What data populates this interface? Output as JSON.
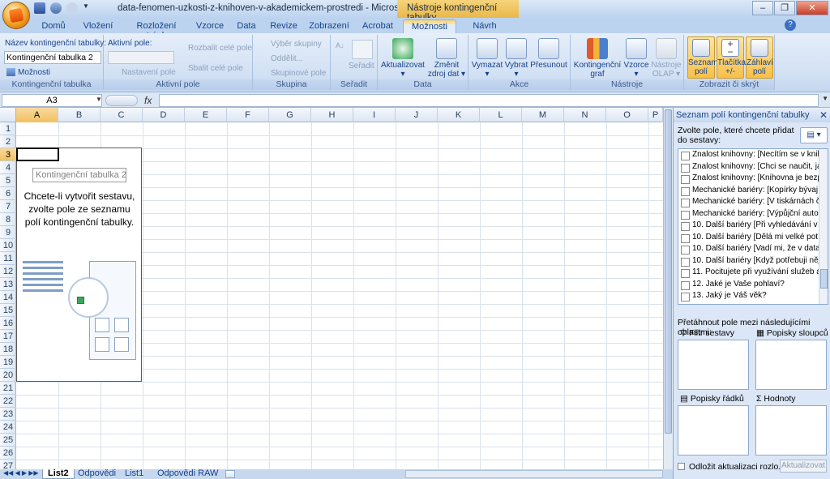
{
  "window": {
    "title": "data-fenomen-uzkosti-z-knihoven-v-akademickem-prostredi - Microsoft Excel",
    "context_title": "Nástroje kontingenční tabulky",
    "buttons": [
      "–",
      "❐",
      "✕"
    ]
  },
  "tabs": [
    {
      "label": "Domů"
    },
    {
      "label": "Vložení"
    },
    {
      "label": "Rozložení stránky"
    },
    {
      "label": "Vzorce"
    },
    {
      "label": "Data"
    },
    {
      "label": "Revize"
    },
    {
      "label": "Zobrazení"
    },
    {
      "label": "Acrobat"
    },
    {
      "label": "Možnosti",
      "active": true
    },
    {
      "label": "Návrh"
    }
  ],
  "ribbon": {
    "g1": {
      "name_label": "Název kontingenční tabulky:",
      "name_value": "Kontingenční tabulka 2",
      "options": "Možnosti",
      "label": "Kontingenční tabulka"
    },
    "g2": {
      "active_field": "Aktivní pole:",
      "settings": "Nastavení pole",
      "expand": "Rozbalit celé pole",
      "collapse": "Sbalit celé pole",
      "label": "Aktivní pole"
    },
    "g3": {
      "group_sel": "Výběr skupiny",
      "ungroup": "Oddělit...",
      "group_field": "Skupinové pole",
      "label": "Skupina"
    },
    "g4": {
      "sort": "Seřadit",
      "label": "Seřadit"
    },
    "g5": {
      "refresh": "Aktualizovat",
      "change_src1": "Změnit",
      "change_src2": "zdroj dat",
      "label": "Data"
    },
    "g6": {
      "clear": "Vymazat",
      "select": "Vybrat",
      "move": "Přesunout",
      "label": "Akce"
    },
    "g7": {
      "chart1": "Kontingenční",
      "chart2": "graf",
      "formulas": "Vzorce",
      "olap1": "Nástroje",
      "olap2": "OLAP",
      "label": "Nástroje"
    },
    "g8": {
      "list1": "Seznam",
      "list2": "polí",
      "btns1": "Tlačítka",
      "btns2": "+/-",
      "hdr1": "Záhlaví",
      "hdr2": "polí",
      "label": "Zobrazit či skrýt"
    }
  },
  "formula": {
    "namebox": "A3",
    "fx": "fx",
    "content": ""
  },
  "columns": [
    "A",
    "B",
    "C",
    "D",
    "E",
    "F",
    "G",
    "H",
    "I",
    "J",
    "K",
    "L",
    "M",
    "N",
    "O",
    "P"
  ],
  "rows": [
    "1",
    "2",
    "3",
    "4",
    "5",
    "6",
    "7",
    "8",
    "9",
    "10",
    "11",
    "12",
    "13",
    "14",
    "15",
    "16",
    "17",
    "18",
    "19",
    "20",
    "21",
    "22",
    "23",
    "24",
    "25",
    "26",
    "27"
  ],
  "pivot": {
    "title": "Kontingenční tabulka 2",
    "message": "Chcete-li vytvořit sestavu, zvolte pole ze seznamu polí kontingenční tabulky."
  },
  "sheets": [
    {
      "label": "List2",
      "active": true
    },
    {
      "label": "Odpovědi"
    },
    {
      "label": "List1"
    },
    {
      "label": "Odpovědi RAW"
    }
  ],
  "panel": {
    "title": "Seznam polí kontingenční tabulky",
    "instructions": "Zvolte pole, které chcete přidat do sestavy:",
    "fields": [
      "Znalost knihovny: [Necítím se v kniho...",
      "Znalost knihovny: [Chci se naučit, jak...",
      "Znalost knihovny: [Knihovna je bezp...",
      "Mechanické bariéry: [Kopírky bývají o...",
      "Mechanické bariéry: [V tiskárnách ča...",
      "Mechanické bariéry: [Výpůjční autom...",
      "10. Další bariéry [Při vyhledávání v d...",
      "10. Další bariéry [Dělá mi velké potíže...",
      "10. Další bariéry [Vadí mi, že v datab...",
      "10. Další bariéry [Když potřebuji něja...",
      "11. Pocitujete při využívání služeb ak...",
      "12. Jaké je Vaše pohlaví?",
      "13. Jaký je Váš věk?"
    ],
    "drag_label": "Přetáhnout pole mezi následujícími oblastmi:",
    "areas": {
      "filter": "Filtr sestavy",
      "columns": "Popisky sloupců",
      "rows": "Popisky řádků",
      "values": "Hodnoty"
    },
    "defer": "Odložit aktualizaci rozlo...",
    "update": "Aktualizovat"
  }
}
